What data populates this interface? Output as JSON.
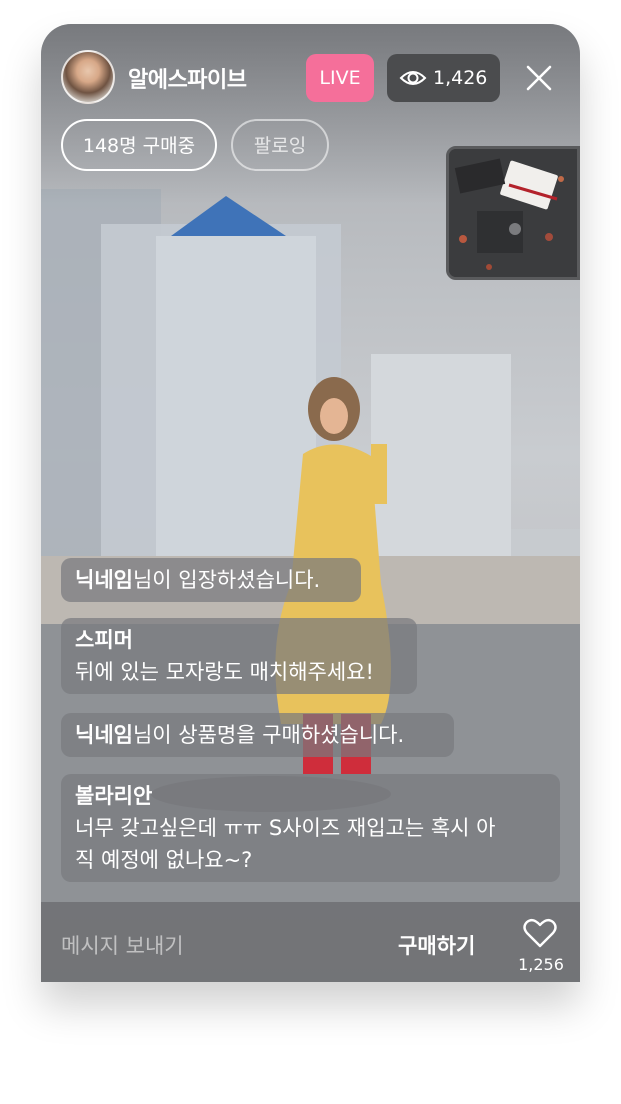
{
  "header": {
    "channel_name": "알에스파이브",
    "live_label": "LIVE",
    "viewer_count": "1,426"
  },
  "pills": {
    "buying": "148명 구매중",
    "follow": "팔로잉"
  },
  "chat": [
    {
      "name": "닉네임",
      "text": "님이 입장하셨습니다."
    },
    {
      "name": "스피머",
      "text": "뒤에 있는 모자랑도 매치해주세요!"
    },
    {
      "name": "닉네임",
      "text": "님이 상품명을 구매하셨습니다."
    },
    {
      "name": "볼라리안",
      "text": "너무 갖고싶은데 ㅠㅠ S사이즈 재입고는 혹시 아직 예정에 없나요~?",
      "line1": "너무 갖고싶은데 ㅠㅠ S사이즈 재입고는 혹시 아",
      "line2": "직 예정에 없나요~?"
    }
  ],
  "bottom": {
    "message_placeholder": "메시지 보내기",
    "buy_label": "구매하기",
    "like_count": "1,256"
  },
  "colors": {
    "live": "#f56f9a",
    "viewer_badge": "#4b4c4e"
  }
}
